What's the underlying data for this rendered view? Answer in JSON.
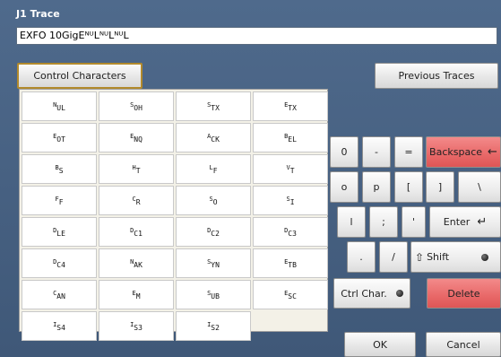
{
  "window": {
    "title": "J1 Trace"
  },
  "trace": {
    "value": "EXFO 10GigEᴺᵁLᴺᵁLᴺᵁL"
  },
  "buttons": {
    "control_characters": "Control Characters",
    "previous_traces": "Previous Traces",
    "ok": "OK",
    "cancel": "Cancel"
  },
  "control_chars": [
    {
      "a": "N",
      "b": "UL"
    },
    {
      "a": "S",
      "b": "OH"
    },
    {
      "a": "S",
      "b": "TX"
    },
    {
      "a": "E",
      "b": "TX"
    },
    {
      "a": "E",
      "b": "OT"
    },
    {
      "a": "E",
      "b": "NQ"
    },
    {
      "a": "A",
      "b": "CK"
    },
    {
      "a": "B",
      "b": "EL"
    },
    {
      "a": "B",
      "b": "S"
    },
    {
      "a": "H",
      "b": "T"
    },
    {
      "a": "L",
      "b": "F"
    },
    {
      "a": "V",
      "b": "T"
    },
    {
      "a": "F",
      "b": "F"
    },
    {
      "a": "C",
      "b": "R"
    },
    {
      "a": "S",
      "b": "O"
    },
    {
      "a": "S",
      "b": "I"
    },
    {
      "a": "D",
      "b": "LE"
    },
    {
      "a": "D",
      "b": "C1"
    },
    {
      "a": "D",
      "b": "C2"
    },
    {
      "a": "D",
      "b": "C3"
    },
    {
      "a": "D",
      "b": "C4"
    },
    {
      "a": "N",
      "b": "AK"
    },
    {
      "a": "S",
      "b": "YN"
    },
    {
      "a": "E",
      "b": "TB"
    },
    {
      "a": "C",
      "b": "AN"
    },
    {
      "a": "E",
      "b": "M"
    },
    {
      "a": "S",
      "b": "UB"
    },
    {
      "a": "E",
      "b": "SC"
    },
    {
      "a": "I",
      "b": "S4"
    },
    {
      "a": "I",
      "b": "S3"
    },
    {
      "a": "I",
      "b": "S2"
    }
  ],
  "keyboard": {
    "row1": [
      "0",
      "-",
      "=",
      "Backspace"
    ],
    "row2": [
      "o",
      "p",
      "[",
      "]",
      "\\"
    ],
    "row3": [
      "l",
      ";",
      "'",
      "Enter"
    ],
    "row4": [
      ".",
      "/",
      "Shift"
    ],
    "ctrl_char": "Ctrl Char.",
    "delete": "Delete"
  },
  "icons": {
    "backspace": "←",
    "enter": "↵",
    "shift": "⇧"
  }
}
